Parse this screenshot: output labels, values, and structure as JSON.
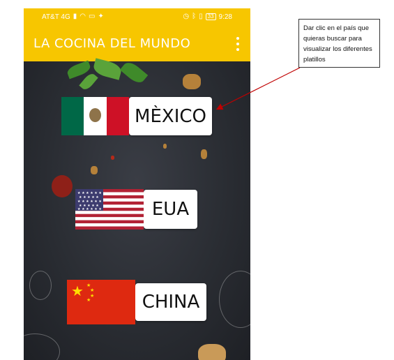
{
  "status_bar": {
    "carrier": "AT&T 4G",
    "time": "9:28",
    "battery": "33"
  },
  "app_bar": {
    "title": "LA COCINA DEL MUNDO",
    "menu_icon": "more-vert-icon"
  },
  "countries": [
    {
      "label": "MÈXICO",
      "flag": "mexico-flag"
    },
    {
      "label": "EUA",
      "flag": "usa-flag"
    },
    {
      "label": "CHINA",
      "flag": "china-flag"
    }
  ],
  "annotation": {
    "text": "Dar clic en el país que quieras buscar para visualizar los diferentes platillos"
  },
  "colors": {
    "app_bar": "#f7c600",
    "background": "#23262d",
    "arrow": "#c00000"
  }
}
